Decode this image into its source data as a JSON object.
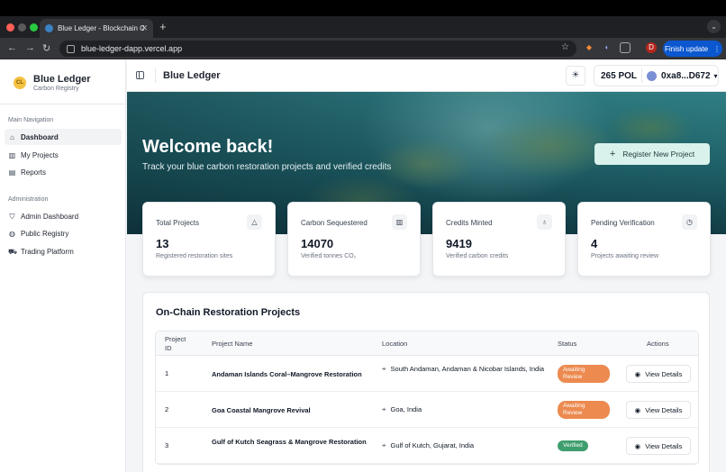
{
  "browser": {
    "tab_title": "Blue Ledger - Blockchain Ca",
    "url": "blue-ledger-dapp.vercel.app",
    "finish_update": "Finish update",
    "profile_initial": "D"
  },
  "sidebar": {
    "brand_name": "Blue Ledger",
    "brand_sub": "Carbon Registry",
    "logo_text": "CL",
    "main_nav_title": "Main Navigation",
    "main_items": [
      {
        "label": "Dashboard",
        "icon": "home-icon"
      },
      {
        "label": "My Projects",
        "icon": "chart-icon"
      },
      {
        "label": "Reports",
        "icon": "document-icon"
      }
    ],
    "admin_title": "Administration",
    "admin_items": [
      {
        "label": "Admin Dashboard",
        "icon": "shield-icon"
      },
      {
        "label": "Public Registry",
        "icon": "globe-icon"
      },
      {
        "label": "Trading Platform",
        "icon": "cart-icon"
      }
    ]
  },
  "header": {
    "title": "Blue Ledger",
    "balance": "265 POL",
    "address": "0xa8...D672"
  },
  "hero": {
    "title": "Welcome back!",
    "subtitle": "Track your blue carbon restoration projects and verified credits",
    "register_label": "Register New Project"
  },
  "stats": [
    {
      "label": "Total Projects",
      "value": "13",
      "desc": "Registered restoration sites",
      "icon": "bell-icon"
    },
    {
      "label": "Carbon Sequestered",
      "value": "14070",
      "desc": "Verified tonnes CO₂",
      "icon": "bar-chart-icon"
    },
    {
      "label": "Credits Minted",
      "value": "9419",
      "desc": "Verified carbon credits",
      "icon": "award-icon"
    },
    {
      "label": "Pending Verification",
      "value": "4",
      "desc": "Projects awaiting review",
      "icon": "clock-icon"
    }
  ],
  "projects": {
    "title": "On-Chain Restoration Projects",
    "columns": {
      "id": "Project ID",
      "name": "Project Name",
      "location": "Location",
      "status": "Status",
      "actions": "Actions"
    },
    "view_label": "View Details",
    "rows": [
      {
        "id": "1",
        "name": "Andaman Islands Coral–Mangrove Restoration",
        "location": "South Andaman, Andaman & Nicobar Islands, India",
        "status": "Awaiting Review"
      },
      {
        "id": "2",
        "name": "Goa Coastal Mangrove Revival",
        "location": "Goa, India",
        "status": "Awaiting Review"
      },
      {
        "id": "3",
        "name": "Gulf of Kutch Seagrass & Mangrove Restoration",
        "location": "Gulf of Kutch, Gujarat, India",
        "status": "Verified"
      }
    ]
  }
}
